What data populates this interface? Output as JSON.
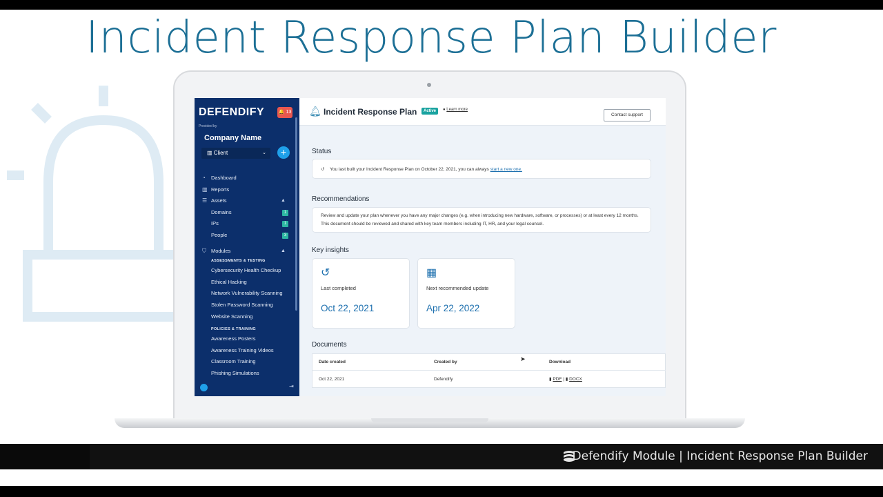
{
  "headline": "Incident Response Plan Builder",
  "app": {
    "logo": "DEFENDIFY",
    "notification_count": "13",
    "provided_by_label": "Provided by",
    "company_name": "Company Name",
    "client_select": "Client",
    "add_label": "+"
  },
  "sidebar": {
    "items": [
      {
        "label": "Dashboard",
        "icon": "dashboard-icon"
      },
      {
        "label": "Reports",
        "icon": "chart-icon"
      },
      {
        "label": "Assets",
        "icon": "list-icon"
      }
    ],
    "assets": [
      {
        "label": "Domains",
        "count": "1"
      },
      {
        "label": "IPs",
        "count": "1"
      },
      {
        "label": "People",
        "count": "3"
      }
    ],
    "modules_label": "Modules",
    "assessments_heading": "ASSESSMENTS & TESTING",
    "assessments": [
      "Cybersecurity Health Checkup",
      "Ethical Hacking",
      "Network Vulnerability Scanning",
      "Stolen Password Scanning",
      "Website Scanning"
    ],
    "policies_heading": "POLICIES & TRAINING",
    "policies": [
      "Awareness Posters",
      "Awareness Training Videos",
      "Classroom Training",
      "Phishing Simulations"
    ]
  },
  "page": {
    "title": "Incident Response Plan",
    "badge": "Active",
    "learn_more": "Learn more",
    "contact_support": "Contact support",
    "status_title": "Status",
    "status_text": "You last built your Incident Response Plan on October 22, 2021, you can always",
    "status_link": "start a new one.",
    "recommendations_title": "Recommendations",
    "recommendations_text": "Review and update your plan whenever you have any major changes (e.g. when introducing new hardware, software, or processes) or at least every 12 months. This document should be reviewed and shared with key team members including IT, HR, and your legal counsel.",
    "insights_title": "Key insights",
    "insights": [
      {
        "label": "Last completed",
        "value": "Oct 22, 2021",
        "icon": "history-icon"
      },
      {
        "label": "Next recommended update",
        "value": "Apr 22, 2022",
        "icon": "calendar-icon"
      }
    ],
    "documents_title": "Documents",
    "table": {
      "headers": [
        "Date created",
        "Created by",
        "Download"
      ],
      "rows": [
        {
          "date": "Oct 22, 2021",
          "created_by": "Defendify",
          "pdf": "PDF",
          "docx": "DOCX"
        }
      ]
    }
  },
  "footer": {
    "text": "Defendify Module  |  Incident Response Plan Builder"
  },
  "colors": {
    "accent": "#1c6f95",
    "sidebar": "#0c2f6b",
    "badge": "#1aa3a0",
    "notification": "#e8574f"
  }
}
